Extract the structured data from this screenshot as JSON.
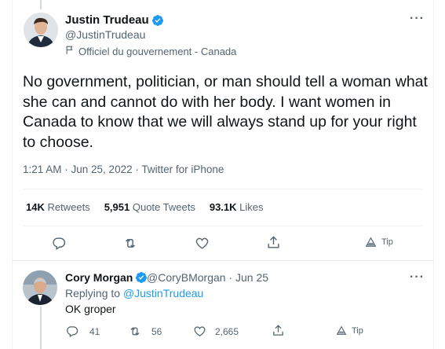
{
  "main_tweet": {
    "author_name": "Justin Trudeau",
    "author_handle": "@JustinTrudeau",
    "gov_label": "Officiel du gouvernement - Canada",
    "text": "No government, politician, or man should tell a woman what she can and cannot do with her body. I want women in Canada to know that we will always stand up for your right to choose.",
    "timestamp": "1:21 AM · Jun 25, 2022 · Twitter for iPhone",
    "stats": {
      "retweets_count": "14K",
      "retweets_label": "Retweets",
      "quotes_count": "5,951",
      "quotes_label": "Quote Tweets",
      "likes_count": "93.1K",
      "likes_label": "Likes"
    },
    "actions": {
      "tip_label": "Tip"
    }
  },
  "reply": {
    "author_name": "Cory Morgan",
    "author_handle": "@CoryBMorgan · Jun 25",
    "replying_prefix": "Replying to ",
    "replying_to": "@JustinTrudeau",
    "text": "OK groper",
    "reply_count": "41",
    "retweet_count": "56",
    "like_count": "2,665",
    "tip_label": "Tip"
  },
  "icons": {
    "more": "more-horizontal-icon",
    "verified": "verified-badge-icon",
    "flag": "flag-icon",
    "reply": "reply-icon",
    "retweet": "retweet-icon",
    "like": "heart-icon",
    "share": "share-icon",
    "tip": "tip-icon"
  },
  "colors": {
    "accent": "#1d9bf0",
    "secondary_text": "#536471",
    "primary_text": "#0f1419"
  }
}
